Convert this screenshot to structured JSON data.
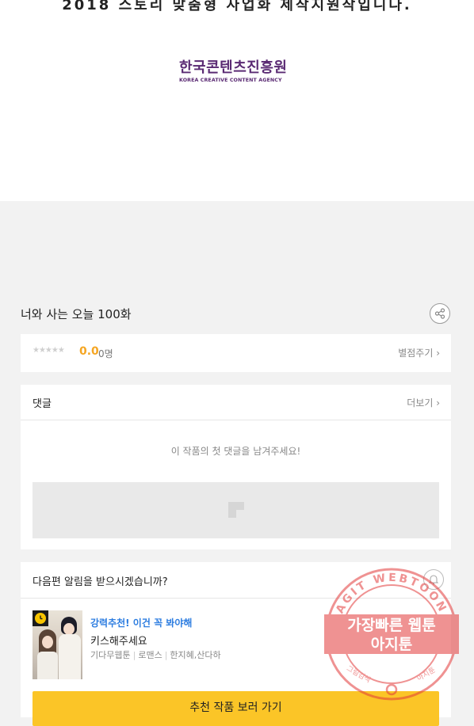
{
  "banner": {
    "support_text": "2018 스토리 맞춤형 사업화 제작지원작입니다.",
    "logo_ko": "한국콘텐츠진흥원",
    "logo_en": "KOREA CREATIVE CONTENT AGENCY"
  },
  "episode": {
    "title": "너와 사는 오늘 100화",
    "share_icon": "share-icon"
  },
  "rating": {
    "stars": "★★★★★",
    "score": "0.0",
    "votes": "0명",
    "rate_label": "별점주기 ›"
  },
  "comments": {
    "title": "댓글",
    "more_label": "더보기 ›",
    "empty_message": "이 작품의 첫 댓글을 남겨주세요!"
  },
  "notify": {
    "question": "다음편 알림을 받으시겠습니까?",
    "bell_icon": "bell-icon"
  },
  "recommend": {
    "tag": "강력추천! 이건 꼭 봐야해",
    "title": "키스해주세요",
    "platform": "기다무웹툰",
    "genre": "로맨스",
    "authors": "한지혜,산다하",
    "button_label": "추천 작품 보러 가기"
  },
  "watermark": {
    "ring_text": "AGIT WEBTOON",
    "line1": "가장빠른 웹툰",
    "line2": "아지툰",
    "bottom_left": "그림검색",
    "bottom_right": "아지툰"
  },
  "colors": {
    "accent_yellow": "#fbc527",
    "score_orange": "#f5a623",
    "link_blue": "#2d7de0",
    "kocca_purple": "#5a2a73",
    "stamp_red": "#e23a3a"
  }
}
